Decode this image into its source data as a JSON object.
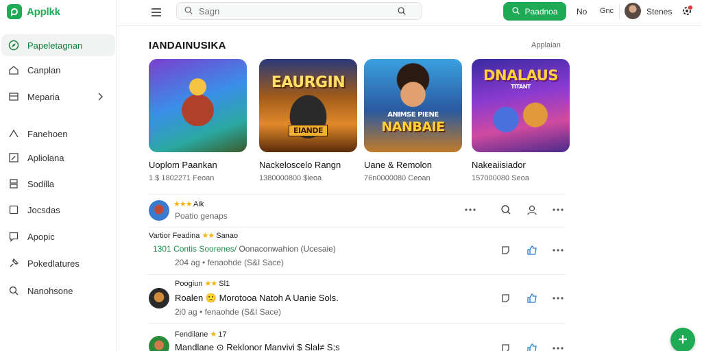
{
  "app": {
    "name": "Applkk"
  },
  "sidebar": {
    "items": [
      {
        "label": "Papeletagnan",
        "icon": "compass-icon",
        "active": true
      },
      {
        "label": "Canplan",
        "icon": "home-icon"
      },
      {
        "label": "Meparia",
        "icon": "window-icon",
        "has_chevron": true
      },
      {
        "label": "Fanehoen",
        "icon": "chevron-up-icon"
      },
      {
        "label": "Apliolana",
        "icon": "edit-icon"
      },
      {
        "label": "Sodilla",
        "icon": "layers-icon"
      },
      {
        "label": "Jocsdas",
        "icon": "square-icon"
      },
      {
        "label": "Apopic",
        "icon": "chat-icon"
      },
      {
        "label": "Pokedlatures",
        "icon": "pin-icon"
      },
      {
        "label": "Nanohsone",
        "icon": "search-icon"
      }
    ]
  },
  "header": {
    "search_placeholder": "Sagn",
    "primary_button": "Paadnoa",
    "link_1": "No",
    "link_2": "Gnc",
    "user_name": "Stenes"
  },
  "section": {
    "title": "IANDAINUSIKA",
    "link": "Applaian"
  },
  "cards": [
    {
      "title": "Uoplom Paankan",
      "meta": "1 $ 1802271 Feoan"
    },
    {
      "title": "Nackeloscelo Rangn",
      "meta": "1380000800 $ieoa",
      "art_text_1": "EAURGIN",
      "art_text_2": "EIANDE"
    },
    {
      "title": "Uane & Remolon",
      "meta": "76n0000080 Ceoan",
      "art_text_1": "ANIMSE PIENE",
      "art_text_2": "NANBAIE"
    },
    {
      "title": "Nakeaiisiador",
      "meta": "157000080 Seoa",
      "art_text_1": "DNALAUS",
      "art_text_2": "TITANT"
    }
  ],
  "posts": [
    {
      "head": "Aik",
      "stars": "★★★",
      "body": "Poatio genaps"
    },
    {
      "head": "Vartior Feadina",
      "stars": "★★",
      "head_suffix": "Sanao",
      "body_green": "1301 Contis Soorenes/",
      "body_rest": "Oonaconwahion (Ucesaie)",
      "sub": "204 ag • fenaohde (S&I Sace)"
    },
    {
      "head": "Poogiun",
      "stars": "★★",
      "head_suffix": "Sl1",
      "body": "Roalen 🙁 Morotooa Natoh A Uanie Sols.",
      "sub": "2i0 ag • fenaohde (S&I Sace)"
    },
    {
      "head": "Fendilane",
      "stars": "★",
      "head_suffix": "17",
      "body": "Mandlane ⊙ Reklonor Manvivi $ Slal≠ S;s"
    }
  ],
  "colors": {
    "accent": "#1faa55",
    "star": "#f5b301",
    "link_blue": "#2a7ad5"
  }
}
